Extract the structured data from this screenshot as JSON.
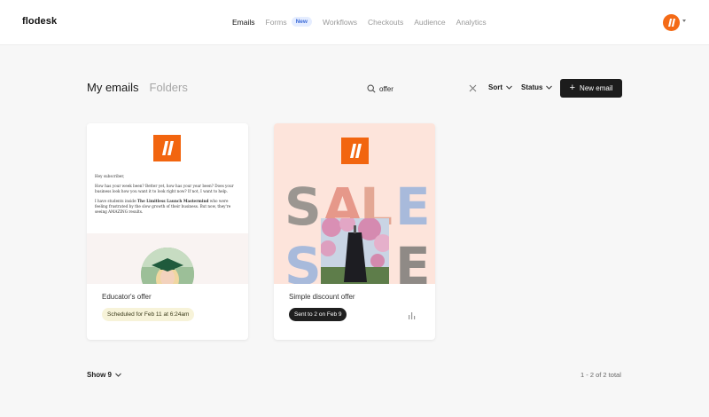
{
  "app": {
    "logo_text": "flodesk"
  },
  "nav": {
    "items": [
      {
        "label": "Emails",
        "active": true
      },
      {
        "label": "Forms",
        "active": false,
        "badge": "New"
      },
      {
        "label": "Workflows",
        "active": false
      },
      {
        "label": "Checkouts",
        "active": false
      },
      {
        "label": "Audience",
        "active": false
      },
      {
        "label": "Analytics",
        "active": false
      }
    ]
  },
  "page": {
    "tabs": [
      {
        "label": "My emails",
        "active": true
      },
      {
        "label": "Folders",
        "active": false
      }
    ],
    "search": {
      "value": "offer",
      "icon": "search-icon"
    },
    "sort_label": "Sort",
    "status_label": "Status",
    "new_email_label": "New email"
  },
  "cards": [
    {
      "title": "Educator's offer",
      "status": "Scheduled for Feb 11 at 6:24am",
      "status_type": "scheduled",
      "preview": {
        "greeting": "Hey subscriber,",
        "line1": "How has your week been? Better yet, how has your year been? Does your business look how you want it to look right now? If not, I want to help.",
        "line2_pre": "I have students inside ",
        "line2_bold": "The Limitless Launch Mastermind",
        "line2_post": " who were feeling frustrated by the slow growth of their business. But now, they're seeing AMAZING results."
      }
    },
    {
      "title": "Simple discount offer",
      "status": "Sent to 2 on Feb 9",
      "status_type": "sent",
      "preview": {
        "row1": [
          "S",
          "A",
          "L",
          "E"
        ],
        "row2": [
          "S",
          "",
          "",
          "E"
        ]
      }
    }
  ],
  "footer": {
    "show_label": "Show 9",
    "total_text": "1 - 2 of 2 total"
  },
  "colors": {
    "brand": "#f2650f",
    "primary_button": "#1c1c1c",
    "scheduled_pill": "#f7f3d9",
    "sale_background": "#fde4db"
  }
}
